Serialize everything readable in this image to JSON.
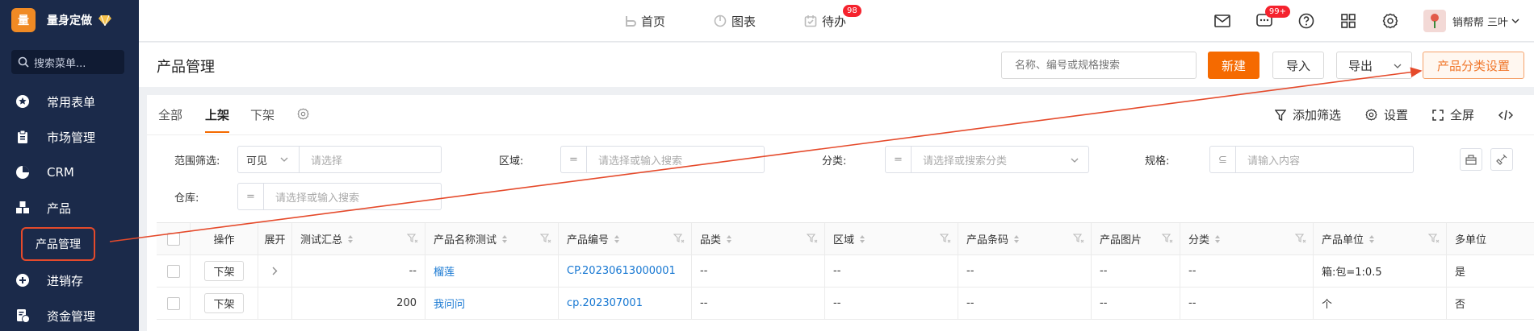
{
  "brand": {
    "logo_char": "量",
    "name": "量身定做"
  },
  "sidebar": {
    "search_placeholder": "搜索菜单...",
    "items": [
      {
        "label": "常用表单",
        "icon": "star-icon"
      },
      {
        "label": "市场管理",
        "icon": "clipboard-icon"
      },
      {
        "label": "CRM",
        "icon": "pie-icon"
      },
      {
        "label": "产品",
        "icon": "boxes-icon"
      },
      {
        "label": "进销存",
        "icon": "inventory-icon"
      },
      {
        "label": "资金管理",
        "icon": "finance-icon"
      }
    ],
    "active_sub": "产品管理"
  },
  "topnav": {
    "items": [
      {
        "label": "首页",
        "icon": "home-icon"
      },
      {
        "label": "图表",
        "icon": "chart-icon"
      },
      {
        "label": "待办",
        "icon": "calendar-icon",
        "badge": "98"
      }
    ]
  },
  "topright": {
    "message_badge": "99+",
    "user_name": "销帮帮 三叶"
  },
  "page": {
    "title": "产品管理",
    "search_placeholder": "名称、编号或规格搜索",
    "btn_new": "新建",
    "btn_import": "导入",
    "btn_export": "导出",
    "btn_category": "产品分类设置"
  },
  "tabs": {
    "all": "全部",
    "on": "上架",
    "off": "下架"
  },
  "tools": {
    "add_filter": "添加筛选",
    "settings": "设置",
    "fullscreen": "全屏"
  },
  "filters": {
    "scope_label": "范围筛选:",
    "scope_value": "可见",
    "scope_placeholder": "请选择",
    "region_label": "区域:",
    "region_placeholder": "请选择或输入搜索",
    "category_label": "分类:",
    "category_placeholder": "请选择或搜索分类",
    "spec_label": "规格:",
    "spec_placeholder": "请输入内容",
    "warehouse_label": "仓库:",
    "warehouse_placeholder": "请选择或输入搜索",
    "eq_symbol": "=",
    "contains_symbol": "⊆"
  },
  "table": {
    "headers": {
      "op": "操作",
      "expand": "展开",
      "summary": "测试汇总",
      "name": "产品名称测试",
      "code": "产品编号",
      "brand": "品类",
      "region": "区域",
      "barcode": "产品条码",
      "image": "产品图片",
      "category": "分类",
      "unit": "产品单位",
      "multi": "多单位"
    },
    "rows": [
      {
        "op": "下架",
        "summary": "--",
        "name": "榴莲",
        "code": "CP.20230613000001",
        "brand": "--",
        "region": "--",
        "barcode": "--",
        "image": "--",
        "category": "--",
        "unit": "箱:包=1:0.5",
        "multi": "是"
      },
      {
        "op": "下架",
        "summary": "200",
        "name": "我问问",
        "code": "cp.202307001",
        "brand": "--",
        "region": "--",
        "barcode": "--",
        "image": "--",
        "category": "--",
        "unit": "个",
        "multi": "否"
      }
    ]
  },
  "colors": {
    "sidebar_bg": "#1b2a4a",
    "accent": "#f56a00",
    "annotation": "#e54a2b",
    "link": "#1677d2"
  }
}
